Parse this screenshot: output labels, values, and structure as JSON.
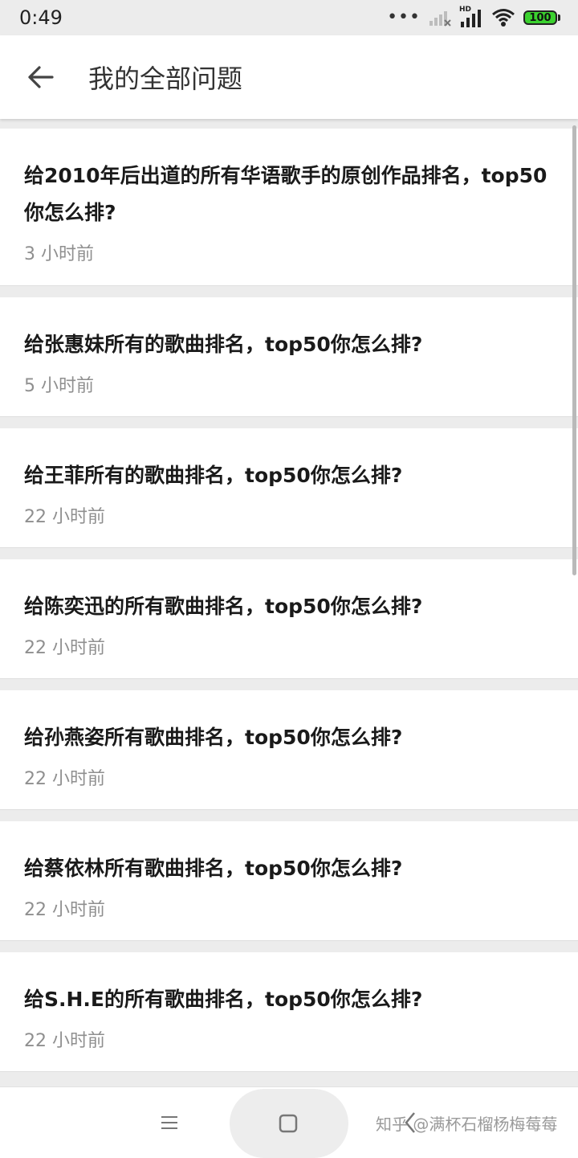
{
  "status": {
    "time": "0:49",
    "battery": "100",
    "hd": "HD"
  },
  "header": {
    "title": "我的全部问题"
  },
  "questions": [
    {
      "title": "给2010年后出道的所有华语歌手的原创作品排名，top50你怎么排?",
      "time": "3 小时前"
    },
    {
      "title": "给张惠妹所有的歌曲排名，top50你怎么排?",
      "time": "5 小时前"
    },
    {
      "title": "给王菲所有的歌曲排名，top50你怎么排?",
      "time": "22 小时前"
    },
    {
      "title": "给陈奕迅的所有歌曲排名，top50你怎么排?",
      "time": "22 小时前"
    },
    {
      "title": "给孙燕姿所有歌曲排名，top50你怎么排?",
      "time": "22 小时前"
    },
    {
      "title": "给蔡依林所有歌曲排名，top50你怎么排?",
      "time": "22 小时前"
    },
    {
      "title": "给S.H.E的所有歌曲排名，top50你怎么排?",
      "time": "22 小时前"
    }
  ],
  "watermark": "知乎 @满杯石榴杨梅莓莓",
  "colors": {
    "battery": "#3bd12f",
    "background": "#ececec",
    "card": "#ffffff",
    "meta_text": "#8f8f8f"
  },
  "icons": [
    "back-arrow-icon",
    "wifi-icon",
    "signal-icon",
    "menu-icon",
    "home-icon",
    "nav-back-icon"
  ]
}
